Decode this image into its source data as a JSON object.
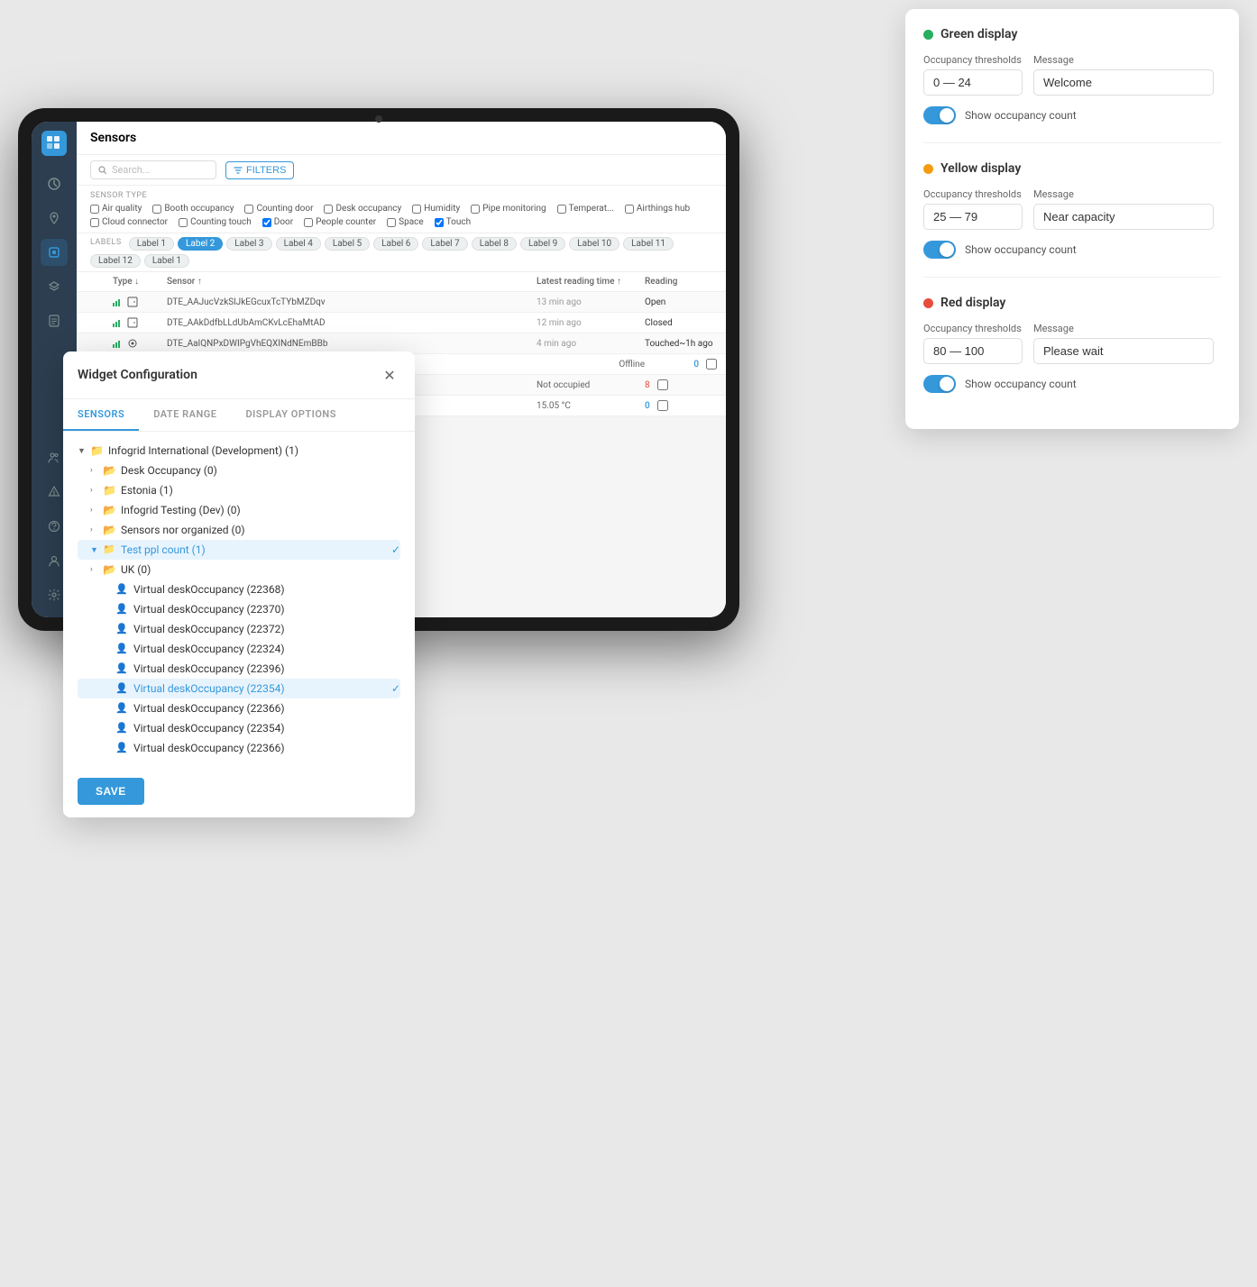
{
  "page": {
    "title": "Sensors"
  },
  "sidebar": {
    "icons": [
      "grid",
      "chart",
      "folder",
      "sensor",
      "layers",
      "file",
      "users",
      "alert",
      "help",
      "user",
      "settings"
    ]
  },
  "toolbar": {
    "search_placeholder": "Search...",
    "filters_label": "FILTERS"
  },
  "sensor_type": {
    "label": "SENSOR TYPE",
    "checkboxes": [
      {
        "label": "Air quality",
        "checked": false
      },
      {
        "label": "Booth occupancy",
        "checked": false
      },
      {
        "label": "Counting door",
        "checked": false
      },
      {
        "label": "Desk occupancy",
        "checked": false
      },
      {
        "label": "Humidity",
        "checked": false
      },
      {
        "label": "Pipe monitoring",
        "checked": false
      },
      {
        "label": "Temperat...",
        "checked": false
      },
      {
        "label": "Airthings hub",
        "checked": false
      },
      {
        "label": "Cloud connector",
        "checked": false
      },
      {
        "label": "Counting touch",
        "checked": false
      },
      {
        "label": "Door",
        "checked": true
      },
      {
        "label": "People counter",
        "checked": false
      },
      {
        "label": "Space",
        "checked": false
      },
      {
        "label": "Touch",
        "checked": true
      }
    ]
  },
  "labels": {
    "section_label": "LABELS",
    "items": [
      "Label 1",
      "Label 2",
      "Label 3",
      "Label 4",
      "Label 5",
      "Label 6",
      "Label 7",
      "Label 8",
      "Label 9",
      "Label 10",
      "Label 11",
      "Label 12",
      "Label 1"
    ],
    "active_index": 1
  },
  "table": {
    "headers": [
      "",
      "Type ↓",
      "Sensor ↑",
      "Latest reading time ↑",
      "Reading"
    ],
    "rows": [
      {
        "type_icon": "signal",
        "device_icon": "door",
        "sensor": "DTE_AAJucVzkSlJkEGcuxTcTYbMZDqv",
        "time": "13 min ago",
        "reading": "Open"
      },
      {
        "type_icon": "signal",
        "device_icon": "door",
        "sensor": "DTE_AAkDdfbLLdUbAmCKvLcEhaMtAD",
        "time": "12 min ago",
        "reading": "Closed"
      },
      {
        "type_icon": "signal",
        "device_icon": "sensor",
        "sensor": "DTE_AaIQNPxDWIPgVhEQXINdNEmBBb",
        "time": "4 min ago",
        "reading": "Touched~1h ago"
      },
      {
        "sensor": "",
        "time": "",
        "reading": "Offline",
        "count": "0"
      },
      {
        "sensor": "",
        "time": "",
        "reading": "Not occupied",
        "count": "8"
      },
      {
        "sensor": "",
        "time": "",
        "reading": "15.05 °C",
        "count": "0"
      }
    ]
  },
  "widget_modal": {
    "title": "Widget Configuration",
    "tabs": [
      "SENSORS",
      "DATE RANGE",
      "DISPLAY OPTIONS"
    ],
    "active_tab": 0,
    "tree": [
      {
        "level": 0,
        "expanded": true,
        "type": "folder",
        "label": "Infogrid International (Development) (1)",
        "selected": false,
        "checked": false
      },
      {
        "level": 1,
        "expanded": false,
        "type": "folder",
        "label": "Desk Occupancy (0)",
        "selected": false,
        "checked": false
      },
      {
        "level": 1,
        "expanded": false,
        "type": "folder-filled",
        "label": "Estonia (1)",
        "selected": false,
        "checked": false
      },
      {
        "level": 1,
        "expanded": false,
        "type": "folder",
        "label": "Infogrid Testing (Dev) (0)",
        "selected": false,
        "checked": false
      },
      {
        "level": 1,
        "expanded": false,
        "type": "folder",
        "label": "Sensors nor organized (0)",
        "selected": false,
        "checked": false
      },
      {
        "level": 1,
        "expanded": true,
        "type": "folder-filled-selected",
        "label": "Test ppl count (1)",
        "selected": true,
        "checked": true
      },
      {
        "level": 1,
        "expanded": false,
        "type": "folder",
        "label": "UK (0)",
        "selected": false,
        "checked": false
      },
      {
        "level": 2,
        "expanded": false,
        "type": "person",
        "label": "Virtual deskOccupancy (22368)",
        "selected": false,
        "checked": false
      },
      {
        "level": 2,
        "expanded": false,
        "type": "person",
        "label": "Virtual deskOccupancy (22370)",
        "selected": false,
        "checked": false
      },
      {
        "level": 2,
        "expanded": false,
        "type": "person",
        "label": "Virtual deskOccupancy (22372)",
        "selected": false,
        "checked": false
      },
      {
        "level": 2,
        "expanded": false,
        "type": "person",
        "label": "Virtual deskOccupancy (22324)",
        "selected": false,
        "checked": false
      },
      {
        "level": 2,
        "expanded": false,
        "type": "person",
        "label": "Virtual deskOccupancy (22396)",
        "selected": false,
        "checked": false
      },
      {
        "level": 2,
        "expanded": false,
        "type": "person-selected",
        "label": "Virtual deskOccupancy (22354)",
        "selected": true,
        "checked": true
      },
      {
        "level": 2,
        "expanded": false,
        "type": "person",
        "label": "Virtual deskOccupancy (22366)",
        "selected": false,
        "checked": false
      },
      {
        "level": 2,
        "expanded": false,
        "type": "person",
        "label": "Virtual deskOccupancy (22354)",
        "selected": false,
        "checked": false
      },
      {
        "level": 2,
        "expanded": false,
        "type": "person",
        "label": "Virtual deskOccupancy (22366)",
        "selected": false,
        "checked": false
      }
    ],
    "save_label": "SAVE"
  },
  "display_options": {
    "sections": [
      {
        "id": "green",
        "dot_color": "green",
        "title": "Green display",
        "threshold_label": "Occupancy thresholds",
        "threshold_value": "0 — 24",
        "message_label": "Message",
        "message_value": "Welcome",
        "toggle_label": "Show occupancy count",
        "toggle_on": true
      },
      {
        "id": "yellow",
        "dot_color": "yellow",
        "title": "Yellow display",
        "threshold_label": "Occupancy thresholds",
        "threshold_value": "25 — 79",
        "message_label": "Message",
        "message_value": "Near capacity",
        "toggle_label": "Show occupancy count",
        "toggle_on": true
      },
      {
        "id": "red",
        "dot_color": "red",
        "title": "Red display",
        "threshold_label": "Occupancy thresholds",
        "threshold_value": "80 — 100",
        "message_label": "Message",
        "message_value": "Please wait",
        "toggle_label": "Show occupancy count",
        "toggle_on": true
      }
    ]
  }
}
